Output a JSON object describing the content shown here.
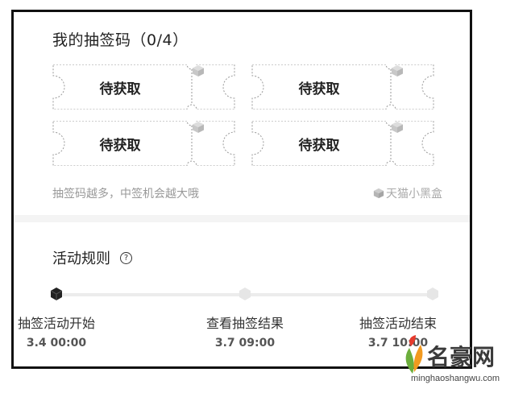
{
  "lottery": {
    "title": "我的抽签码（0/4）",
    "tickets": [
      {
        "label": "待获取"
      },
      {
        "label": "待获取"
      },
      {
        "label": "待获取"
      },
      {
        "label": "待获取"
      }
    ],
    "hint": "抽签码越多，中签机会越大哦",
    "brand": "天猫小黑盒"
  },
  "rules": {
    "title": "活动规则",
    "help_icon_glyph": "?",
    "steps": [
      {
        "label": "抽签活动开始",
        "time": "3.4 00:00",
        "active": true
      },
      {
        "label": "查看抽签结果",
        "time": "3.7 09:00",
        "active": false
      },
      {
        "label": "抽签活动结束",
        "time": "3.7 10:00",
        "active": false
      }
    ]
  },
  "watermark": {
    "logo_text": "名豪网",
    "url": "minghaoshangwu.com"
  },
  "colors": {
    "border": "#111111",
    "dashed": "#9a9a9a",
    "muted": "#999999",
    "track": "#ececec",
    "active_dot": "#222222"
  }
}
